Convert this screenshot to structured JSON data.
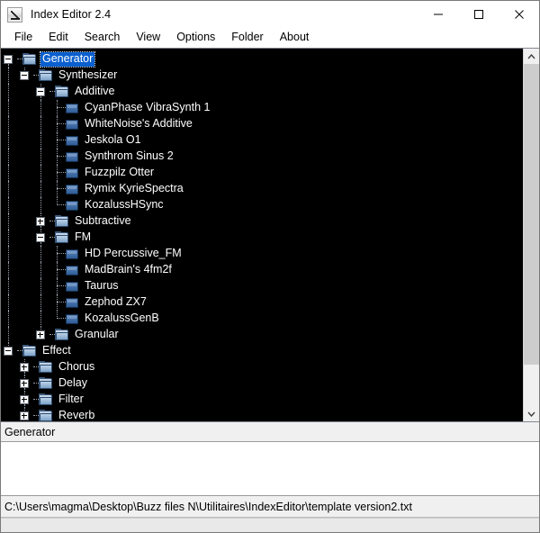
{
  "window": {
    "title": "Index Editor 2.4",
    "icon": "angle-app-icon",
    "controls": {
      "minimize": "minimize-icon",
      "maximize": "maximize-icon",
      "close": "close-icon"
    }
  },
  "menubar": {
    "items": [
      {
        "label": "File"
      },
      {
        "label": "Edit"
      },
      {
        "label": "Search"
      },
      {
        "label": "View"
      },
      {
        "label": "Options"
      },
      {
        "label": "Folder"
      },
      {
        "label": "About"
      }
    ]
  },
  "tree": {
    "nodes": [
      {
        "label": "Generator",
        "depth": 0,
        "type": "folder",
        "state": "expanded",
        "selected": true
      },
      {
        "label": "Synthesizer",
        "depth": 1,
        "type": "folder",
        "state": "expanded",
        "selected": false
      },
      {
        "label": "Additive",
        "depth": 2,
        "type": "folder",
        "state": "expanded",
        "selected": false
      },
      {
        "label": "CyanPhase VibraSynth 1",
        "depth": 3,
        "type": "leaf",
        "state": "none",
        "selected": false
      },
      {
        "label": "WhiteNoise's Additive",
        "depth": 3,
        "type": "leaf",
        "state": "none",
        "selected": false
      },
      {
        "label": "Jeskola O1",
        "depth": 3,
        "type": "leaf",
        "state": "none",
        "selected": false
      },
      {
        "label": "Synthrom Sinus 2",
        "depth": 3,
        "type": "leaf",
        "state": "none",
        "selected": false
      },
      {
        "label": "Fuzzpilz Otter",
        "depth": 3,
        "type": "leaf",
        "state": "none",
        "selected": false
      },
      {
        "label": "Rymix KyrieSpectra",
        "depth": 3,
        "type": "leaf",
        "state": "none",
        "selected": false
      },
      {
        "label": "KozalussHSync",
        "depth": 3,
        "type": "leaf",
        "state": "last",
        "selected": false
      },
      {
        "label": "Subtractive",
        "depth": 2,
        "type": "folder",
        "state": "collapsed",
        "selected": false
      },
      {
        "label": "FM",
        "depth": 2,
        "type": "folder",
        "state": "expanded",
        "selected": false
      },
      {
        "label": "HD Percussive_FM",
        "depth": 3,
        "type": "leaf",
        "state": "none",
        "selected": false
      },
      {
        "label": "MadBrain's 4fm2f",
        "depth": 3,
        "type": "leaf",
        "state": "none",
        "selected": false
      },
      {
        "label": "Taurus",
        "depth": 3,
        "type": "leaf",
        "state": "none",
        "selected": false
      },
      {
        "label": "Zephod ZX7",
        "depth": 3,
        "type": "leaf",
        "state": "none",
        "selected": false
      },
      {
        "label": "KozalussGenB",
        "depth": 3,
        "type": "leaf",
        "state": "last",
        "selected": false
      },
      {
        "label": "Granular",
        "depth": 2,
        "type": "folder",
        "state": "collapsed",
        "selected": false
      },
      {
        "label": "Effect",
        "depth": 0,
        "type": "folder",
        "state": "expanded",
        "selected": false
      },
      {
        "label": "Chorus",
        "depth": 1,
        "type": "folder",
        "state": "collapsed",
        "selected": false
      },
      {
        "label": "Delay",
        "depth": 1,
        "type": "folder",
        "state": "collapsed",
        "selected": false
      },
      {
        "label": "Filter",
        "depth": 1,
        "type": "folder",
        "state": "collapsed",
        "selected": false
      },
      {
        "label": "Reverb",
        "depth": 1,
        "type": "folder",
        "state": "collapsed",
        "selected": false
      }
    ],
    "scrollbar": {
      "up_arrow": "chevron-up-icon",
      "down_arrow": "chevron-down-icon"
    }
  },
  "fields": {
    "name_value": "Generator",
    "description_value": "",
    "path_value": "C:\\Users\\magma\\Desktop\\Buzz files N\\Utilitaires\\IndexEditor\\template version2.txt"
  },
  "statusbar": {
    "text": ""
  },
  "colors": {
    "tree_background": "#000000",
    "tree_text": "#ffffff",
    "selection": "#0a5fce",
    "chrome": "#f0f0f0",
    "folder_icon": "#7ea2c7",
    "leaf_icon": "#2f5c96"
  }
}
